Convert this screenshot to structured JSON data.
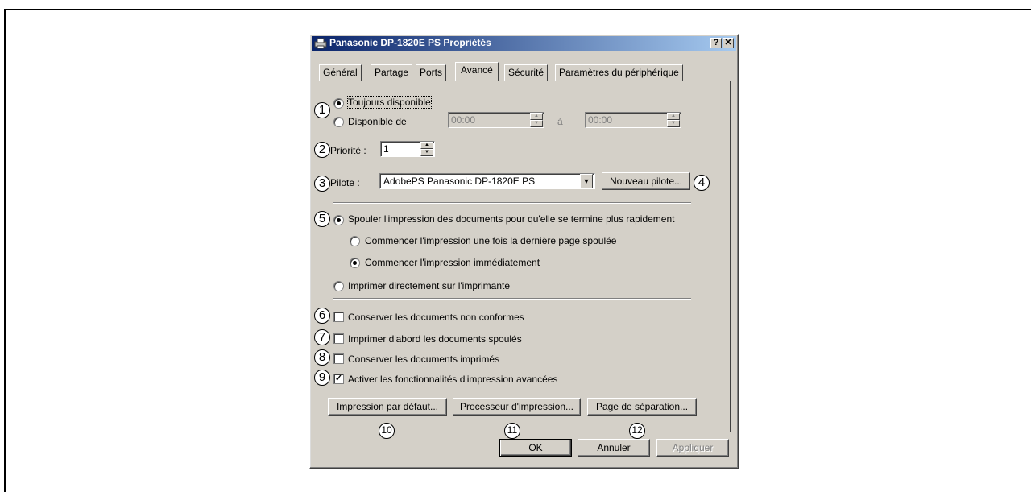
{
  "dialog": {
    "title": "Panasonic DP-1820E PS Propriétés",
    "help_btn": "?",
    "close_btn": "✕"
  },
  "tabs": [
    {
      "label": "Général"
    },
    {
      "label": "Partage"
    },
    {
      "label": "Ports"
    },
    {
      "label": "Avancé"
    },
    {
      "label": "Sécurité"
    },
    {
      "label": "Paramètres du périphérique"
    }
  ],
  "availability": {
    "always_label": "Toujours disponible",
    "from_label": "Disponible de",
    "from_time": "00:00",
    "to_word": "à",
    "to_time": "00:00"
  },
  "priority": {
    "label": "Priorité :",
    "value": "1"
  },
  "driver": {
    "label": "Pilote :",
    "value": "AdobePS Panasonic DP-1820E PS",
    "new_button": "Nouveau pilote..."
  },
  "spool": {
    "spool_label": "Spouler l'impression des documents pour qu'elle se termine plus rapidement",
    "after_last_label": "Commencer l'impression une fois la dernière page spoulée",
    "immediately_label": "Commencer l'impression immédiatement",
    "direct_label": "Imprimer directement sur l'imprimante"
  },
  "options": [
    {
      "label": "Conserver les documents non conformes",
      "checked": false
    },
    {
      "label": "Imprimer d'abord les documents spoulés",
      "checked": false
    },
    {
      "label": "Conserver les documents imprimés",
      "checked": false
    },
    {
      "label": "Activer les fonctionnalités d'impression avancées",
      "checked": true
    }
  ],
  "buttons": {
    "defaults": "Impression par défaut...",
    "processor": "Processeur d'impression...",
    "separator": "Page de séparation...",
    "ok": "OK",
    "cancel": "Annuler",
    "apply": "Appliquer"
  },
  "callouts": [
    "1",
    "2",
    "3",
    "4",
    "5",
    "6",
    "7",
    "8",
    "9",
    "10",
    "11",
    "12"
  ],
  "icons": {
    "printer": "printer-icon",
    "dropdown": "chevron-down-icon",
    "spin_up": "spin-up-icon",
    "spin_down": "spin-down-icon"
  }
}
